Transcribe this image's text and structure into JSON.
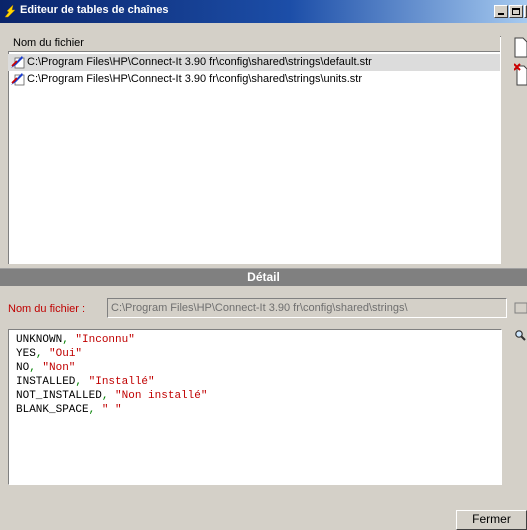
{
  "window": {
    "title": "Editeur de tables de chaînes",
    "controls": {
      "minimize": "_",
      "maximize": "□",
      "close": "x"
    }
  },
  "file_list": {
    "column_header": "Nom du fichier",
    "rows": [
      {
        "path": "C:\\Program Files\\HP\\Connect-It 3.90 fr\\config\\shared\\strings\\default.str",
        "icon": "string-file-icon",
        "selected": true
      },
      {
        "path": "C:\\Program Files\\HP\\Connect-It 3.90 fr\\config\\shared\\strings\\units.str",
        "icon": "string-file-icon",
        "selected": false
      }
    ]
  },
  "side_buttons": {
    "new_icon": "new-document-icon",
    "delete_icon": "delete-document-icon"
  },
  "detail": {
    "title": "Détail",
    "filename_label": "Nom du fichier :",
    "filename_value": "C:\\Program Files\\HP\\Connect-It 3.90 fr\\config\\shared\\strings\\",
    "browse_icon": "browse-folder-icon",
    "search_icon": "search-icon"
  },
  "editor": {
    "lines": [
      {
        "key": "UNKNOWN",
        "sep": ", ",
        "value": "\"Inconnu\""
      },
      {
        "key": "YES",
        "sep": ", ",
        "value": "\"Oui\""
      },
      {
        "key": "NO",
        "sep": ", ",
        "value": "\"Non\""
      },
      {
        "key": "INSTALLED",
        "sep": ", ",
        "value": "\"Installé\""
      },
      {
        "key": "NOT_INSTALLED",
        "sep": ", ",
        "value": "\"Non installé\""
      },
      {
        "key": "BLANK_SPACE",
        "sep": ", ",
        "value": "\" \""
      }
    ],
    "colors": {
      "key": "#000000",
      "separator": "#008000",
      "string": "#c00000"
    }
  },
  "footer": {
    "close_label": "Fermer"
  }
}
